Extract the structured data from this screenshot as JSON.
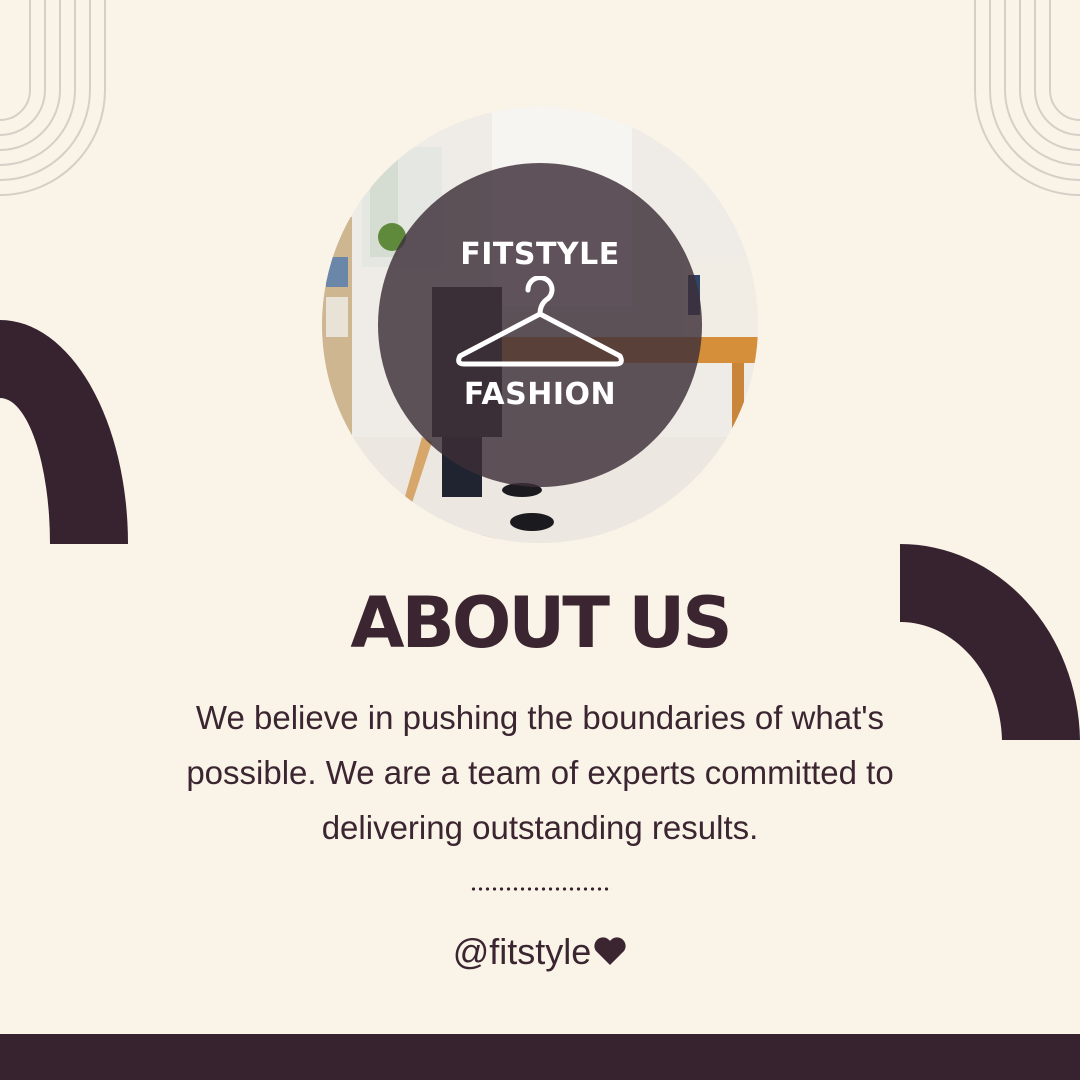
{
  "logo": {
    "top_text": "FITSTYLE",
    "bottom_text": "FASHION",
    "icon": "hanger-icon"
  },
  "heading": "ABOUT US",
  "body_lines": [
    "We believe in pushing the boundaries of what's",
    "possible. We are a team of experts committed to",
    "delivering outstanding results."
  ],
  "handle": "@fitstyle",
  "handle_icon": "heart-icon",
  "colors": {
    "background": "#faf3e8",
    "accent_dark": "#36232f",
    "text": "#3a2530",
    "line_decor": "#d6cfc7"
  }
}
